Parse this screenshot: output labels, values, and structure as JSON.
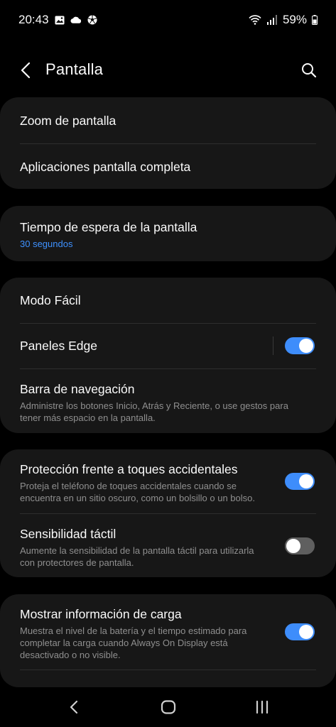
{
  "status_bar": {
    "time": "20:43",
    "battery": "59%",
    "icons_left": [
      "image-icon",
      "cloud-icon",
      "soccer-ball-icon"
    ],
    "icons_right": [
      "wifi-icon",
      "signal-icon",
      "battery-icon"
    ]
  },
  "header": {
    "title": "Pantalla"
  },
  "sections": {
    "zoom": {
      "title": "Zoom de pantalla"
    },
    "fullscreen_apps": {
      "title": "Aplicaciones pantalla completa"
    },
    "timeout": {
      "title": "Tiempo de espera de la pantalla",
      "value": "30 segundos"
    },
    "easy_mode": {
      "title": "Modo Fácil"
    },
    "edge_panels": {
      "title": "Paneles Edge",
      "enabled": true
    },
    "nav_bar": {
      "title": "Barra de navegación",
      "description": "Administre los botones Inicio, Atrás y Reciente, o use gestos para tener más espacio en la pantalla."
    },
    "accidental_touch": {
      "title": "Protección frente a toques accidentales",
      "description": "Proteja el teléfono de toques accidentales cuando se encuentra en un sitio oscuro, como un bolsillo o un bolso.",
      "enabled": true
    },
    "touch_sensitivity": {
      "title": "Sensibilidad táctil",
      "description": "Aumente la sensibilidad de la pantalla táctil para utilizarla con protectores de pantalla.",
      "enabled": false
    },
    "charging_info": {
      "title": "Mostrar información de carga",
      "description": "Muestra el nivel de la batería y el tiempo estimado para completar la carga cuando Always On Display está desactivado o no visible.",
      "enabled": true
    }
  },
  "colors": {
    "accent": "#3e8dfb",
    "card": "#171717",
    "background": "#000000"
  }
}
